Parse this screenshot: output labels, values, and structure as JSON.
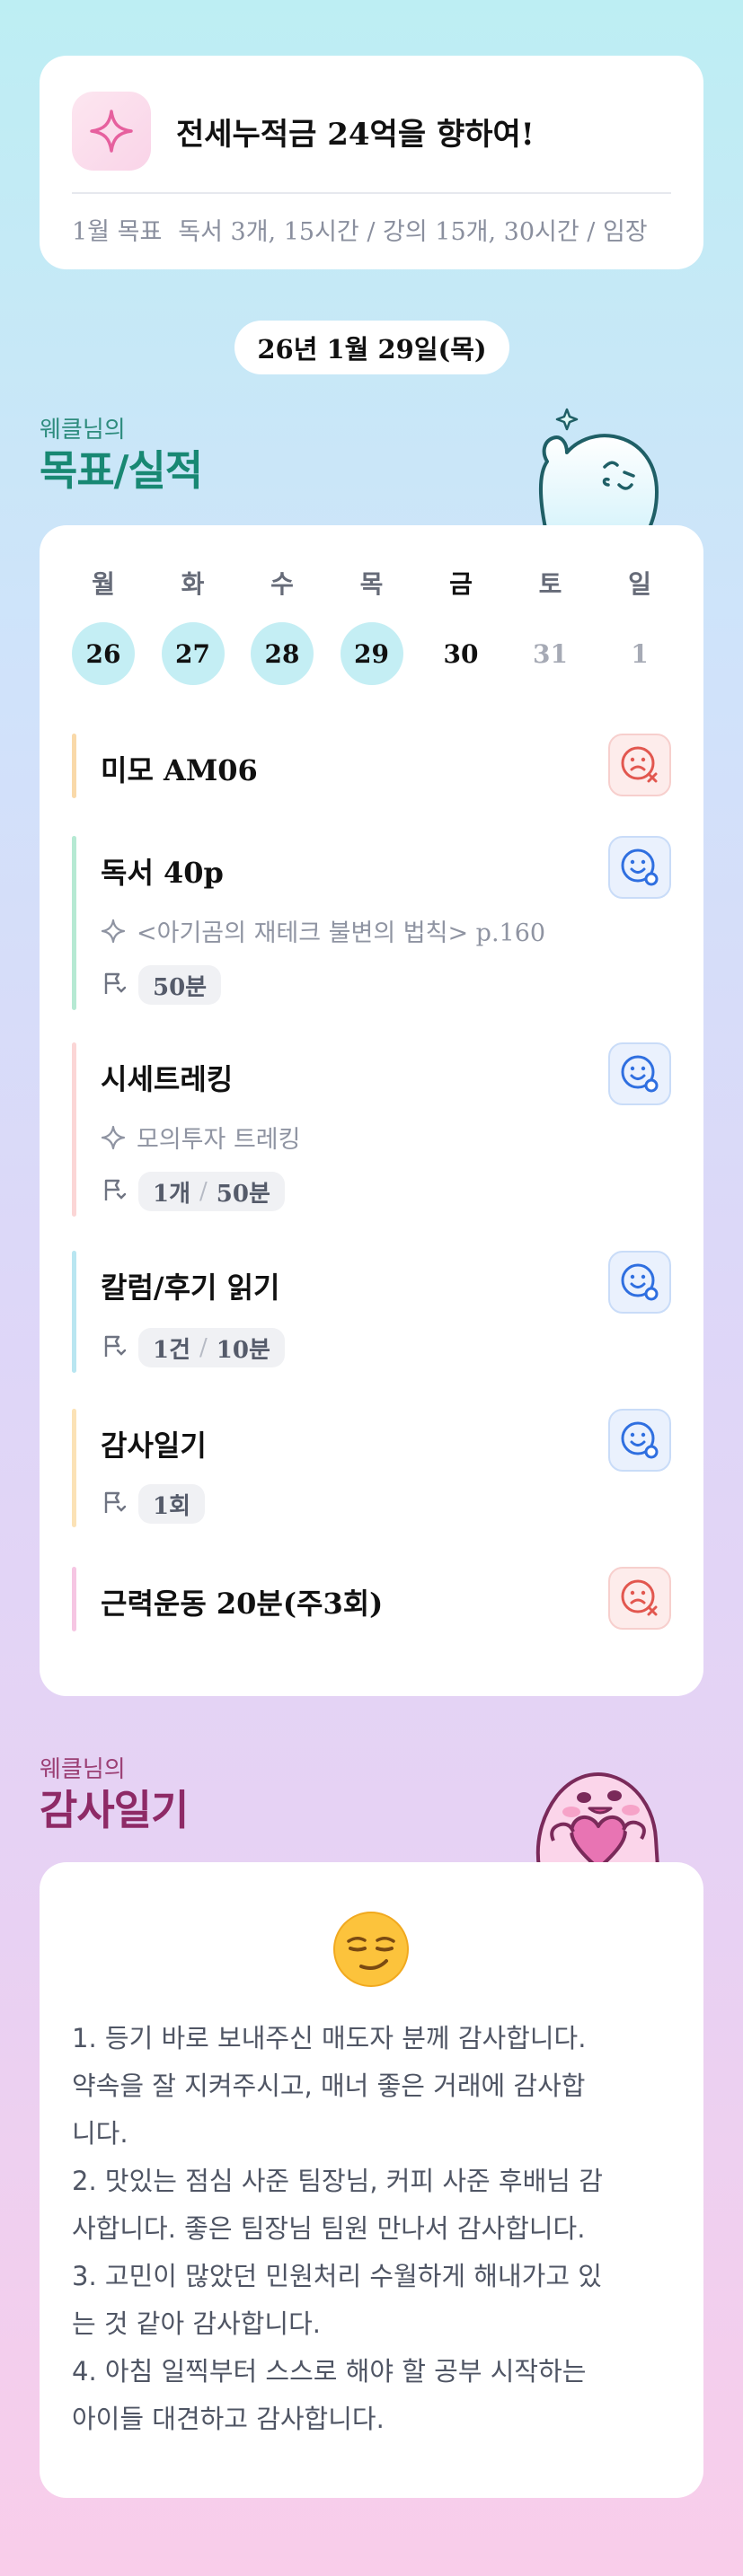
{
  "goal": {
    "title": "전세누적금 24억을 향하여!",
    "label": "1월 목표",
    "detail": "독서 3개, 15시간 / 강의 15개, 30시간 / 임장"
  },
  "date": "26년 1월 29일(목)",
  "goals_section": {
    "small": "웨클님의",
    "big": "목표/실적"
  },
  "week": {
    "days": [
      {
        "name": "월",
        "num": "26",
        "state": "done"
      },
      {
        "name": "화",
        "num": "27",
        "state": "done"
      },
      {
        "name": "수",
        "num": "28",
        "state": "done"
      },
      {
        "name": "목",
        "num": "29",
        "state": "done"
      },
      {
        "name": "금",
        "num": "30",
        "state": "today"
      },
      {
        "name": "토",
        "num": "31",
        "state": "future"
      },
      {
        "name": "일",
        "num": "1",
        "state": "future"
      }
    ]
  },
  "tasks": [
    {
      "name": "미모 AM06",
      "status": "fail",
      "color": "#f9d9a9"
    },
    {
      "name": "독서 40p",
      "status": "done",
      "color": "#b6e9d3",
      "desc": "<아기곰의 재테크 불변의 법칙> p.160",
      "pill_a": "50분"
    },
    {
      "name": "시세트레킹",
      "status": "done",
      "color": "#fbd6d6",
      "desc": "모의투자 트레킹",
      "pill_a": "1개",
      "pill_b": "50분"
    },
    {
      "name": "칼럼/후기 읽기",
      "status": "done",
      "color": "#b9e6f1",
      "pill_a": "1건",
      "pill_b": "10분"
    },
    {
      "name": "감사일기",
      "status": "done",
      "color": "#fbe2b6",
      "pill_a": "1회"
    },
    {
      "name": "근력운동 20분(주3회)",
      "status": "fail",
      "color": "#f6c6e3"
    }
  ],
  "diary_section": {
    "small": "웨클님의",
    "big": "감사일기"
  },
  "diary": {
    "emoji": "smirking-face",
    "lines": [
      "1. 등기 바로 보내주신 매도자 분께 감사합니다.",
      "약속을 잘 지켜주시고, 매너 좋은 거래에 감사합",
      "니다.",
      "2. 맛있는 점심 사준 팀장님, 커피 사준 후배님 감",
      "사합니다. 좋은 팀장님 팀원 만나서 감사합니다.",
      "3. 고민이 많았던 민원처리 수월하게 해내가고 있",
      "는 것 같아 감사합니다.",
      "4. 아침 일찍부터 스스로 해야 할 공부 시작하는",
      "아이들 대견하고 감사합니다."
    ]
  },
  "colors": {
    "accent_green": "#188873",
    "accent_magenta": "#8e2a66",
    "done_day": "#c4eef4"
  }
}
